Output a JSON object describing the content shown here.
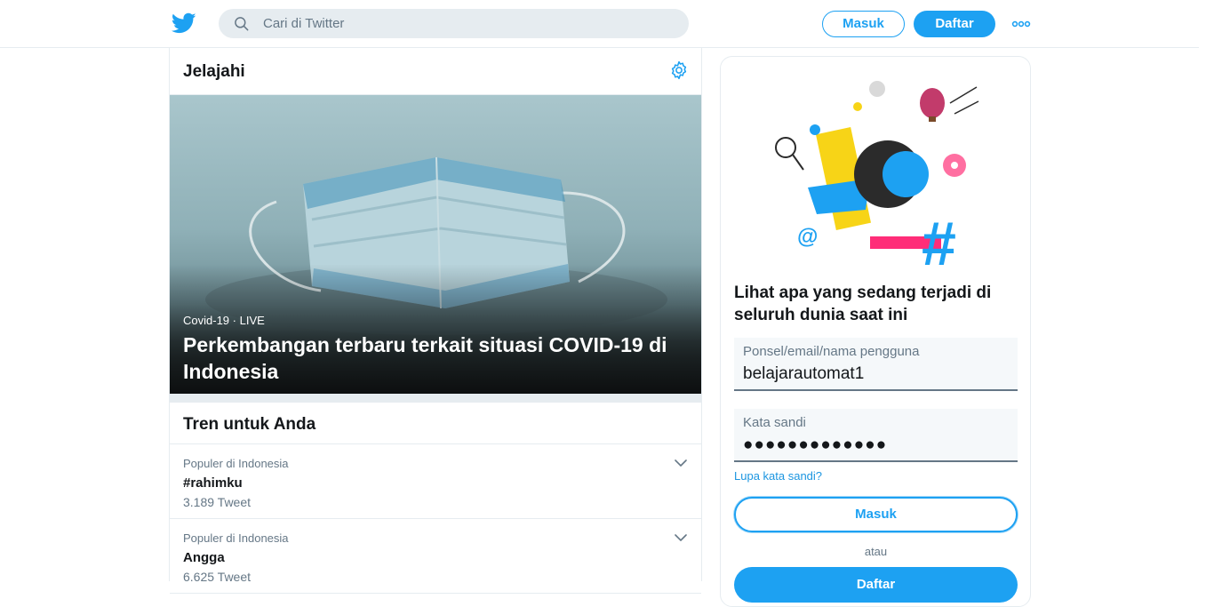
{
  "header": {
    "logo_icon": "twitter-bird-icon",
    "search_placeholder": "Cari di Twitter",
    "search_icon": "search-icon",
    "login_label": "Masuk",
    "signup_label": "Daftar",
    "more_icon": "more-dots-icon"
  },
  "main": {
    "title": "Jelajahi",
    "settings_icon": "gear-icon",
    "hero": {
      "category": "Covid-19",
      "separator": "·",
      "live": "LIVE",
      "title": "Perkembangan terbaru terkait situasi COVID-19 di Indonesia"
    },
    "trends_title": "Tren untuk Anda",
    "trends": [
      {
        "context": "Populer di Indonesia",
        "name": "#rahimku",
        "count": "3.189 Tweet"
      },
      {
        "context": "Populer di Indonesia",
        "name": "Angga",
        "count": "6.625 Tweet"
      }
    ]
  },
  "sidebar": {
    "heading": "Lihat apa yang sedang terjadi di seluruh dunia saat ini",
    "username_label": "Ponsel/email/nama pengguna",
    "username_value": "belajarautomat1",
    "password_label": "Kata sandi",
    "password_value": "●●●●●●●●●●●●●",
    "forgot_label": "Lupa kata sandi?",
    "login_label": "Masuk",
    "or_label": "atau",
    "signup_label": "Daftar"
  },
  "colors": {
    "accent": "#1da1f2",
    "border": "#e6ecf0",
    "secondary_text": "#657786"
  }
}
